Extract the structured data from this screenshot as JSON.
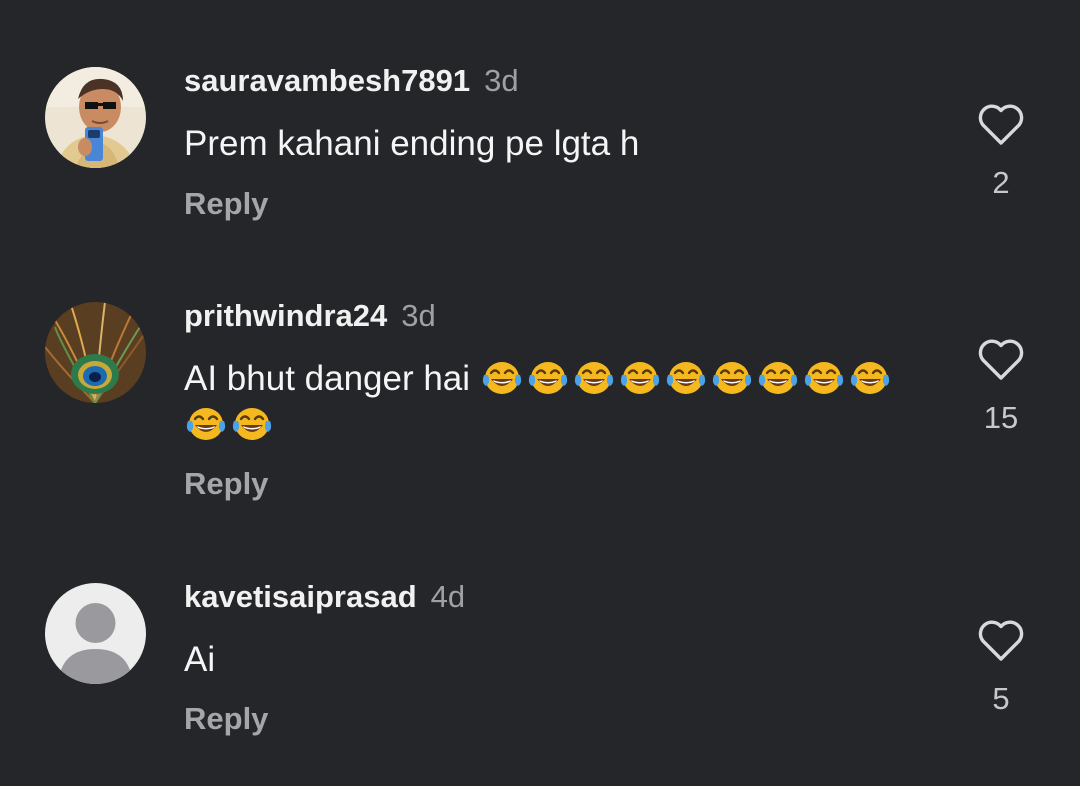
{
  "comments": [
    {
      "username": "sauravambesh7891",
      "time": "3d",
      "text": "Prem kahani ending pe lgta h",
      "emoji_count": 0,
      "reply_label": "Reply",
      "likes": "2",
      "avatar": "photo-man-sunglasses"
    },
    {
      "username": "prithwindra24",
      "time": "3d",
      "text": "AI bhut danger hai ",
      "emoji": "face-with-tears-of-joy",
      "emoji_count": 11,
      "reply_label": "Reply",
      "likes": "15",
      "avatar": "peacock-feather"
    },
    {
      "username": "kavetisaiprasad",
      "time": "4d",
      "text": "Ai",
      "emoji_count": 0,
      "reply_label": "Reply",
      "likes": "5",
      "avatar": "default-profile"
    }
  ],
  "colors": {
    "background": "#25262a",
    "username": "#f1f1f1",
    "muted": "#9fa0a4",
    "heart": "#d9d9dc"
  }
}
